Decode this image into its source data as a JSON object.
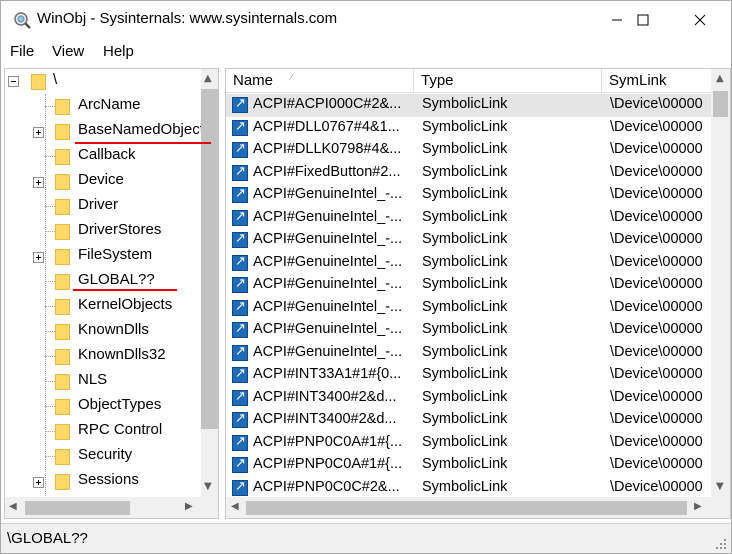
{
  "window": {
    "title": "WinObj - Sysinternals: www.sysinternals.com"
  },
  "menu": {
    "file": "File",
    "view": "View",
    "help": "Help"
  },
  "tree": {
    "root_label": "\\",
    "items": [
      {
        "label": "ArcName",
        "expandable": false
      },
      {
        "label": "BaseNamedObjects",
        "expandable": true
      },
      {
        "label": "Callback",
        "expandable": false
      },
      {
        "label": "Device",
        "expandable": true
      },
      {
        "label": "Driver",
        "expandable": false
      },
      {
        "label": "DriverStores",
        "expandable": false
      },
      {
        "label": "FileSystem",
        "expandable": true
      },
      {
        "label": "GLOBAL??",
        "expandable": false
      },
      {
        "label": "KernelObjects",
        "expandable": false
      },
      {
        "label": "KnownDlls",
        "expandable": false
      },
      {
        "label": "KnownDlls32",
        "expandable": false
      },
      {
        "label": "NLS",
        "expandable": false
      },
      {
        "label": "ObjectTypes",
        "expandable": false
      },
      {
        "label": "RPC Control",
        "expandable": false
      },
      {
        "label": "Security",
        "expandable": false
      },
      {
        "label": "Sessions",
        "expandable": true
      }
    ]
  },
  "list": {
    "columns": {
      "name": "Name",
      "type": "Type",
      "symlink": "SymLink"
    },
    "rows": [
      {
        "name": "ACPI#ACPI000C#2&...",
        "type": "SymbolicLink",
        "symlink": "\\Device\\00000"
      },
      {
        "name": "ACPI#DLL0767#4&1...",
        "type": "SymbolicLink",
        "symlink": "\\Device\\00000"
      },
      {
        "name": "ACPI#DLLK0798#4&...",
        "type": "SymbolicLink",
        "symlink": "\\Device\\00000"
      },
      {
        "name": "ACPI#FixedButton#2...",
        "type": "SymbolicLink",
        "symlink": "\\Device\\00000"
      },
      {
        "name": "ACPI#GenuineIntel_-...",
        "type": "SymbolicLink",
        "symlink": "\\Device\\00000"
      },
      {
        "name": "ACPI#GenuineIntel_-...",
        "type": "SymbolicLink",
        "symlink": "\\Device\\00000"
      },
      {
        "name": "ACPI#GenuineIntel_-...",
        "type": "SymbolicLink",
        "symlink": "\\Device\\00000"
      },
      {
        "name": "ACPI#GenuineIntel_-...",
        "type": "SymbolicLink",
        "symlink": "\\Device\\00000"
      },
      {
        "name": "ACPI#GenuineIntel_-...",
        "type": "SymbolicLink",
        "symlink": "\\Device\\00000"
      },
      {
        "name": "ACPI#GenuineIntel_-...",
        "type": "SymbolicLink",
        "symlink": "\\Device\\00000"
      },
      {
        "name": "ACPI#GenuineIntel_-...",
        "type": "SymbolicLink",
        "symlink": "\\Device\\00000"
      },
      {
        "name": "ACPI#GenuineIntel_-...",
        "type": "SymbolicLink",
        "symlink": "\\Device\\00000"
      },
      {
        "name": "ACPI#INT33A1#1#{0...",
        "type": "SymbolicLink",
        "symlink": "\\Device\\00000"
      },
      {
        "name": "ACPI#INT3400#2&d...",
        "type": "SymbolicLink",
        "symlink": "\\Device\\00000"
      },
      {
        "name": "ACPI#INT3400#2&d...",
        "type": "SymbolicLink",
        "symlink": "\\Device\\00000"
      },
      {
        "name": "ACPI#PNP0C0A#1#{...",
        "type": "SymbolicLink",
        "symlink": "\\Device\\00000"
      },
      {
        "name": "ACPI#PNP0C0A#1#{...",
        "type": "SymbolicLink",
        "symlink": "\\Device\\00000"
      },
      {
        "name": "ACPI#PNP0C0C#2&...",
        "type": "SymbolicLink",
        "symlink": "\\Device\\00000"
      }
    ]
  },
  "status": {
    "path": "\\GLOBAL??"
  },
  "colors": {
    "annotation": "#e0000b",
    "folder": "#ffd966",
    "symlink_icon": "#1e6bb8"
  }
}
